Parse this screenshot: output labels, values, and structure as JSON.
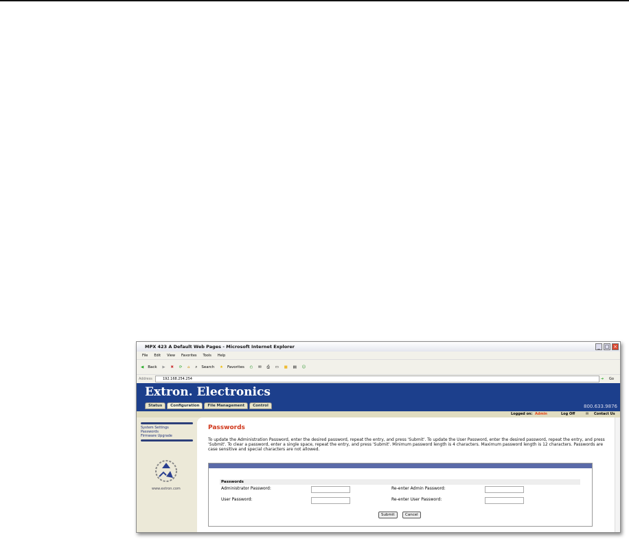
{
  "window": {
    "title": "MPX 423 A Default Web Pages - Microsoft Internet Explorer"
  },
  "menu": [
    "File",
    "Edit",
    "View",
    "Favorites",
    "Tools",
    "Help"
  ],
  "toolbar": {
    "back": "Back",
    "search": "Search",
    "favorites": "Favorites"
  },
  "address": {
    "label": "Address",
    "value": "192.168.254.254",
    "go": "Go"
  },
  "banner": {
    "logo": "Extron. Electronics",
    "phone": "800.633.9876"
  },
  "tabs": [
    "Status",
    "Configuration",
    "File Management",
    "Control"
  ],
  "statusbar": {
    "logged_label": "Logged on:",
    "user": "Admin",
    "logoff": "Log Off",
    "contact": "Contact Us"
  },
  "sidebar": {
    "links": [
      "System Settings",
      "Passwords",
      "Firmware Upgrade"
    ],
    "website": "www.extron.com"
  },
  "main": {
    "title": "Passwords",
    "description": "To update the Administration Password, enter the desired password, repeat the entry, and press 'Submit'.   To update the User Password, enter the desired password, repeat the entry, and press 'Submit'.   To clear a password, enter a single space, repeat the entry, and press 'Submit'.   Minimum password length is 4 characters.  Maximum password length is 12 characters. Passwords are case sensitive and special characters are not allowed.",
    "section": "Passwords",
    "admin_label": "Administrator Password:",
    "user_label": "User Password:",
    "readmin_label": "Re-enter Admin Password:",
    "reuser_label": "Re-enter User Password:",
    "submit": "Submit",
    "cancel": "Cancel"
  }
}
